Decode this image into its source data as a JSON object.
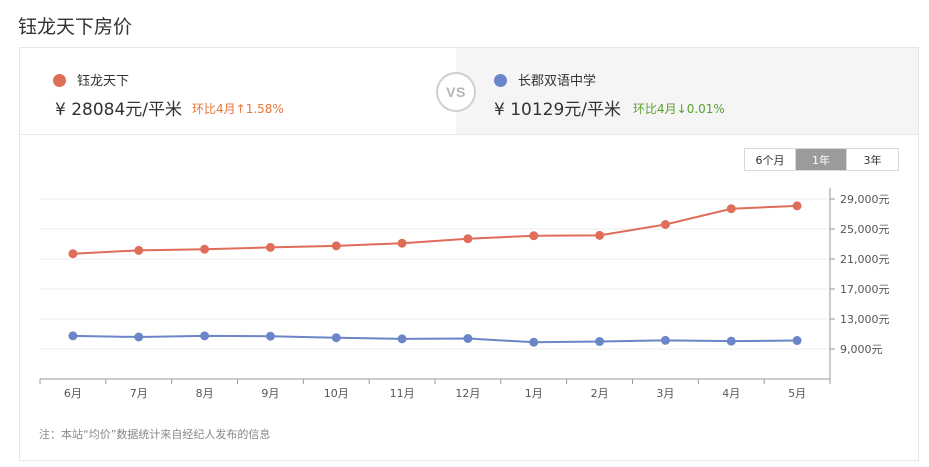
{
  "page": {
    "title": "钰龙天下房价"
  },
  "compare": {
    "left": {
      "name": "钰龙天下",
      "price": "¥ 28084元/平米",
      "change": "环比4月↑1.58%",
      "color": "#e06c5a"
    },
    "right": {
      "name": "长郡双语中学",
      "price": "¥ 10129元/平米",
      "change": "环比4月↓0.01%",
      "color": "#6b86c8"
    },
    "vs_label": "VS",
    "up_color": "#e8753a",
    "down_color": "#5aa12e"
  },
  "range_buttons": [
    {
      "label": "6个月",
      "active": false
    },
    {
      "label": "1年",
      "active": true
    },
    {
      "label": "3年",
      "active": false
    }
  ],
  "note": "注：本站“均价”数据统计来自经纪人发布的信息",
  "chart_data": {
    "type": "line",
    "categories": [
      "6月",
      "7月",
      "8月",
      "9月",
      "10月",
      "11月",
      "12月",
      "1月",
      "2月",
      "3月",
      "4月",
      "5月"
    ],
    "series": [
      {
        "name": "钰龙天下",
        "color": "#e06c5a",
        "values": [
          21700,
          22150,
          22300,
          22550,
          22750,
          23100,
          23700,
          24100,
          24150,
          25600,
          27700,
          28084
        ]
      },
      {
        "name": "长郡双语中学",
        "color": "#6b86c8",
        "values": [
          10750,
          10600,
          10750,
          10700,
          10500,
          10350,
          10400,
          9900,
          10000,
          10150,
          10050,
          10129
        ]
      }
    ],
    "yticks": [
      "29,000元",
      "25,000元",
      "21,000元",
      "17,000元",
      "13,000元",
      "9,000元"
    ],
    "ytick_values": [
      29000,
      25000,
      21000,
      17000,
      13000,
      9000
    ],
    "ylim": [
      9000,
      29000
    ],
    "grid": true,
    "axis_position": "right"
  }
}
